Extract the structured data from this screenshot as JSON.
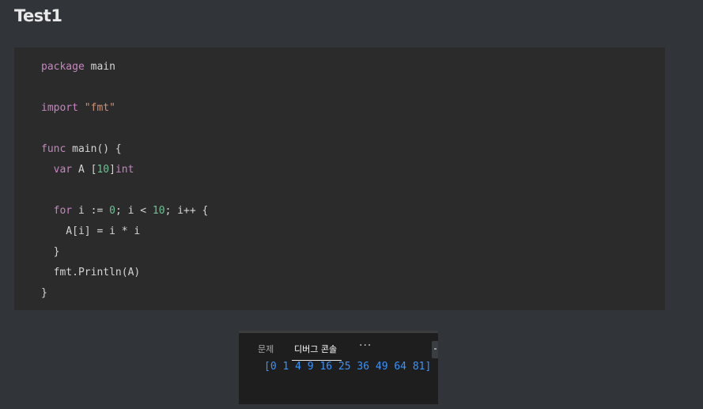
{
  "page": {
    "title": "Test1"
  },
  "code": {
    "language": "go",
    "lines": [
      [
        {
          "t": "kw",
          "v": "package"
        },
        {
          "t": "plain",
          "v": " main"
        }
      ],
      [],
      [
        {
          "t": "kw",
          "v": "import"
        },
        {
          "t": "plain",
          "v": " "
        },
        {
          "t": "str",
          "v": "\"fmt\""
        }
      ],
      [],
      [
        {
          "t": "kw",
          "v": "func"
        },
        {
          "t": "plain",
          "v": " main() {"
        }
      ],
      [
        {
          "t": "plain",
          "v": "  "
        },
        {
          "t": "kw",
          "v": "var"
        },
        {
          "t": "plain",
          "v": " A ["
        },
        {
          "t": "num",
          "v": "10"
        },
        {
          "t": "plain",
          "v": "]"
        },
        {
          "t": "type",
          "v": "int"
        }
      ],
      [],
      [
        {
          "t": "plain",
          "v": "  "
        },
        {
          "t": "kw",
          "v": "for"
        },
        {
          "t": "plain",
          "v": " i := "
        },
        {
          "t": "num",
          "v": "0"
        },
        {
          "t": "plain",
          "v": "; i < "
        },
        {
          "t": "num",
          "v": "10"
        },
        {
          "t": "plain",
          "v": "; i++ {"
        }
      ],
      [
        {
          "t": "plain",
          "v": "    A[i] = i * i"
        }
      ],
      [
        {
          "t": "plain",
          "v": "  }"
        }
      ],
      [
        {
          "t": "plain",
          "v": "  fmt.Println(A)"
        }
      ],
      [
        {
          "t": "plain",
          "v": "}"
        }
      ]
    ]
  },
  "panel": {
    "tabs": {
      "problems": "문제",
      "debug_console": "디버그 콘솔",
      "more": "···"
    },
    "active_tab": "debug_console",
    "console_output": "[0 1 4 9 16 25 36 49 64 81]"
  },
  "colors": {
    "background": "#31353a",
    "code_background": "#2b2b2b",
    "keyword": "#c586c0",
    "string": "#ce9178",
    "number": "#6fc094",
    "text": "#d4d4d4",
    "panel_background": "#1e1e1e",
    "console_text": "#3794ff"
  }
}
